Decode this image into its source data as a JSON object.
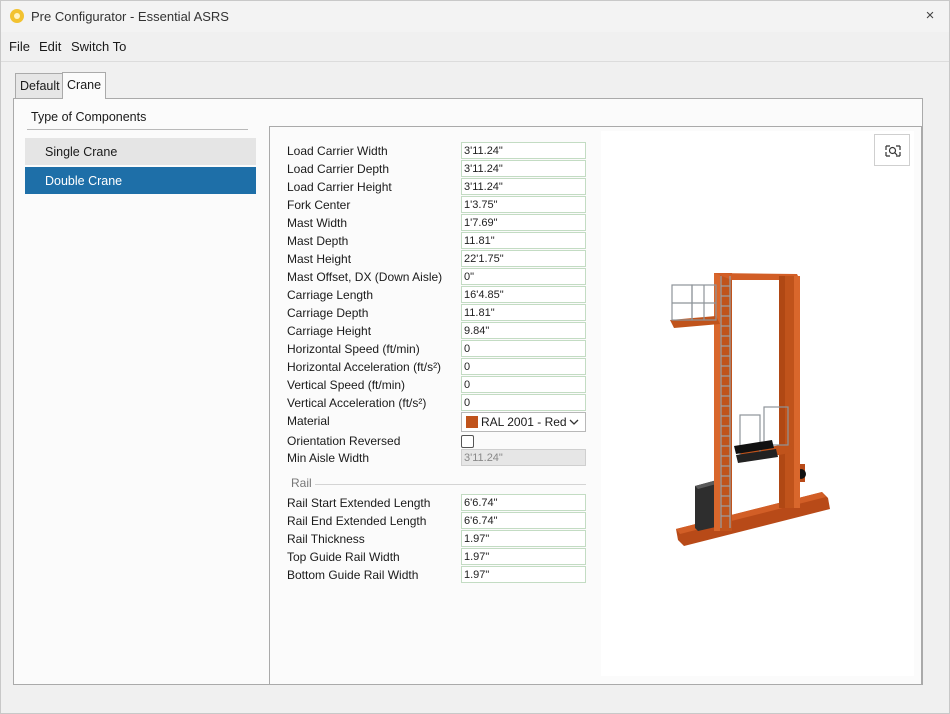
{
  "window": {
    "title": "Pre Configurator - Essential ASRS",
    "close_icon": "×"
  },
  "menu": {
    "file": "File",
    "edit": "Edit",
    "switch_to": "Switch To"
  },
  "tabs": [
    {
      "label": "Default",
      "active": false
    },
    {
      "label": "Crane",
      "active": true
    }
  ],
  "components": {
    "title": "Type of Components",
    "items": [
      {
        "label": "Single Crane",
        "selected": false
      },
      {
        "label": "Double Crane",
        "selected": true
      }
    ]
  },
  "properties": {
    "load_carrier_width": {
      "label": "Load Carrier Width",
      "value": "3'11.24\""
    },
    "load_carrier_depth": {
      "label": "Load Carrier Depth",
      "value": "3'11.24\""
    },
    "load_carrier_height": {
      "label": "Load Carrier Height",
      "value": "3'11.24\""
    },
    "fork_center": {
      "label": "Fork Center",
      "value": "1'3.75\""
    },
    "mast_width": {
      "label": "Mast Width",
      "value": "1'7.69\""
    },
    "mast_depth": {
      "label": "Mast Depth",
      "value": "11.81\""
    },
    "mast_height": {
      "label": "Mast Height",
      "value": "22'1.75\""
    },
    "mast_offset": {
      "label": "Mast Offset, DX (Down Aisle)",
      "value": "0\""
    },
    "carriage_length": {
      "label": "Carriage Length",
      "value": "16'4.85\""
    },
    "carriage_depth": {
      "label": "Carriage Depth",
      "value": "11.81\""
    },
    "carriage_height": {
      "label": "Carriage Height",
      "value": "9.84\""
    },
    "horizontal_speed": {
      "label": "Horizontal Speed (ft/min)",
      "value": "0"
    },
    "horizontal_accel": {
      "label": "Horizontal Acceleration (ft/s²)",
      "value": "0"
    },
    "vertical_speed": {
      "label": "Vertical Speed (ft/min)",
      "value": "0"
    },
    "vertical_accel": {
      "label": "Vertical Acceleration (ft/s²)",
      "value": "0"
    },
    "material": {
      "label": "Material",
      "value": "RAL 2001 - Red",
      "swatch_color": "#c0531b"
    },
    "orientation_reversed": {
      "label": "Orientation Reversed",
      "checked": false
    },
    "min_aisle_width": {
      "label": "Min Aisle Width",
      "value": "3'11.24\""
    }
  },
  "rail": {
    "title": "Rail",
    "start_extended": {
      "label": "Rail Start Extended Length",
      "value": "6'6.74\""
    },
    "end_extended": {
      "label": "Rail End Extended Length",
      "value": "6'6.74\""
    },
    "thickness": {
      "label": "Rail Thickness",
      "value": "1.97\""
    },
    "top_guide": {
      "label": "Top Guide Rail Width",
      "value": "1.97\""
    },
    "bottom_guide": {
      "label": "Bottom Guide Rail Width",
      "value": "1.97\""
    }
  },
  "viewport": {
    "zoom_icon": "zoom-fit-icon",
    "accent_color": "#c0531b",
    "selection_color": "#1e6fa8"
  }
}
